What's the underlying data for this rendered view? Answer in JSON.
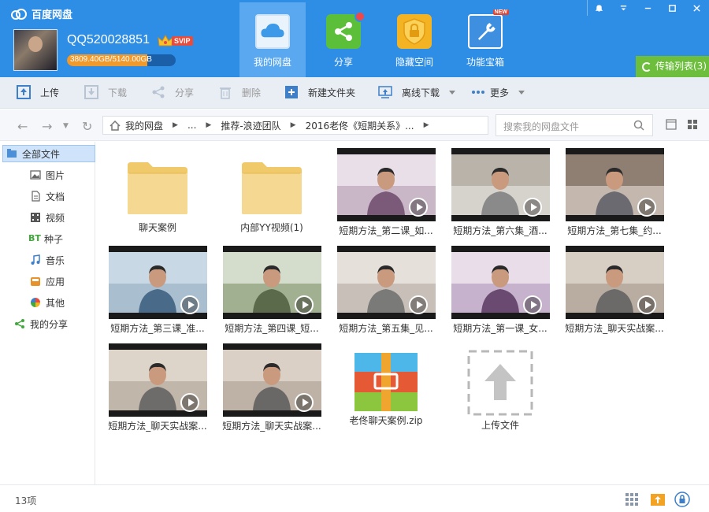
{
  "app": {
    "title": "百度网盘"
  },
  "user": {
    "name": "QQ520028851",
    "vip_badge": "SVIP",
    "quota_text": "3809.40GB/5140.00GB",
    "quota_fraction": 0.741
  },
  "nav_tabs": [
    {
      "label": "我的网盘",
      "icon": "cloud-drive-icon",
      "active": true
    },
    {
      "label": "分享",
      "icon": "share-icon",
      "active": false
    },
    {
      "label": "隐藏空间",
      "icon": "lock-icon",
      "active": false
    },
    {
      "label": "功能宝箱",
      "icon": "toolbox-icon",
      "active": false,
      "badge": "NEW"
    }
  ],
  "transfer": {
    "label": "传输列表(3)"
  },
  "toolbar": {
    "upload": "上传",
    "download": "下载",
    "share": "分享",
    "delete": "删除",
    "new_folder": "新建文件夹",
    "offline": "离线下载",
    "more": "更多"
  },
  "breadcrumb": [
    "我的网盘",
    "...",
    "推荐-浪迹团队",
    "2016老佟《短期关系》..."
  ],
  "search": {
    "placeholder": "搜索我的网盘文件"
  },
  "sidebar": {
    "items": [
      {
        "label": "全部文件",
        "icon": "all-files-icon",
        "selected": true
      },
      {
        "label": "图片",
        "icon": "image-icon"
      },
      {
        "label": "文档",
        "icon": "document-icon"
      },
      {
        "label": "视频",
        "icon": "video-icon"
      },
      {
        "label": "种子",
        "icon": "bt-icon"
      },
      {
        "label": "音乐",
        "icon": "music-icon"
      },
      {
        "label": "应用",
        "icon": "app-icon"
      },
      {
        "label": "其他",
        "icon": "other-icon"
      },
      {
        "label": "我的分享",
        "icon": "share-icon"
      }
    ]
  },
  "files": [
    {
      "name": "聊天案例",
      "type": "folder"
    },
    {
      "name": "内部YY视频(1)",
      "type": "folder"
    },
    {
      "name": "短期方法_第二课_如...",
      "type": "video"
    },
    {
      "name": "短期方法_第六集_酒...",
      "type": "video"
    },
    {
      "name": "短期方法_第七集_约...",
      "type": "video"
    },
    {
      "name": "短期方法_第三课_准...",
      "type": "video"
    },
    {
      "name": "短期方法_第四课_短...",
      "type": "video"
    },
    {
      "name": "短期方法_第五集_见...",
      "type": "video"
    },
    {
      "name": "短期方法_第一课_女...",
      "type": "video"
    },
    {
      "name": "短期方法_聊天实战案...",
      "type": "video"
    },
    {
      "name": "短期方法_聊天实战案...",
      "type": "video"
    },
    {
      "name": "短期方法_聊天实战案...",
      "type": "video"
    },
    {
      "name": "老佟聊天案例.zip",
      "type": "zip"
    },
    {
      "name": "上传文件",
      "type": "upload"
    }
  ],
  "status": {
    "count": "13项"
  },
  "colors": {
    "header": "#2e8ee6",
    "active_tab": "#5aa8f0",
    "transfer": "#6cbe3c",
    "folder": "#f5d993"
  }
}
